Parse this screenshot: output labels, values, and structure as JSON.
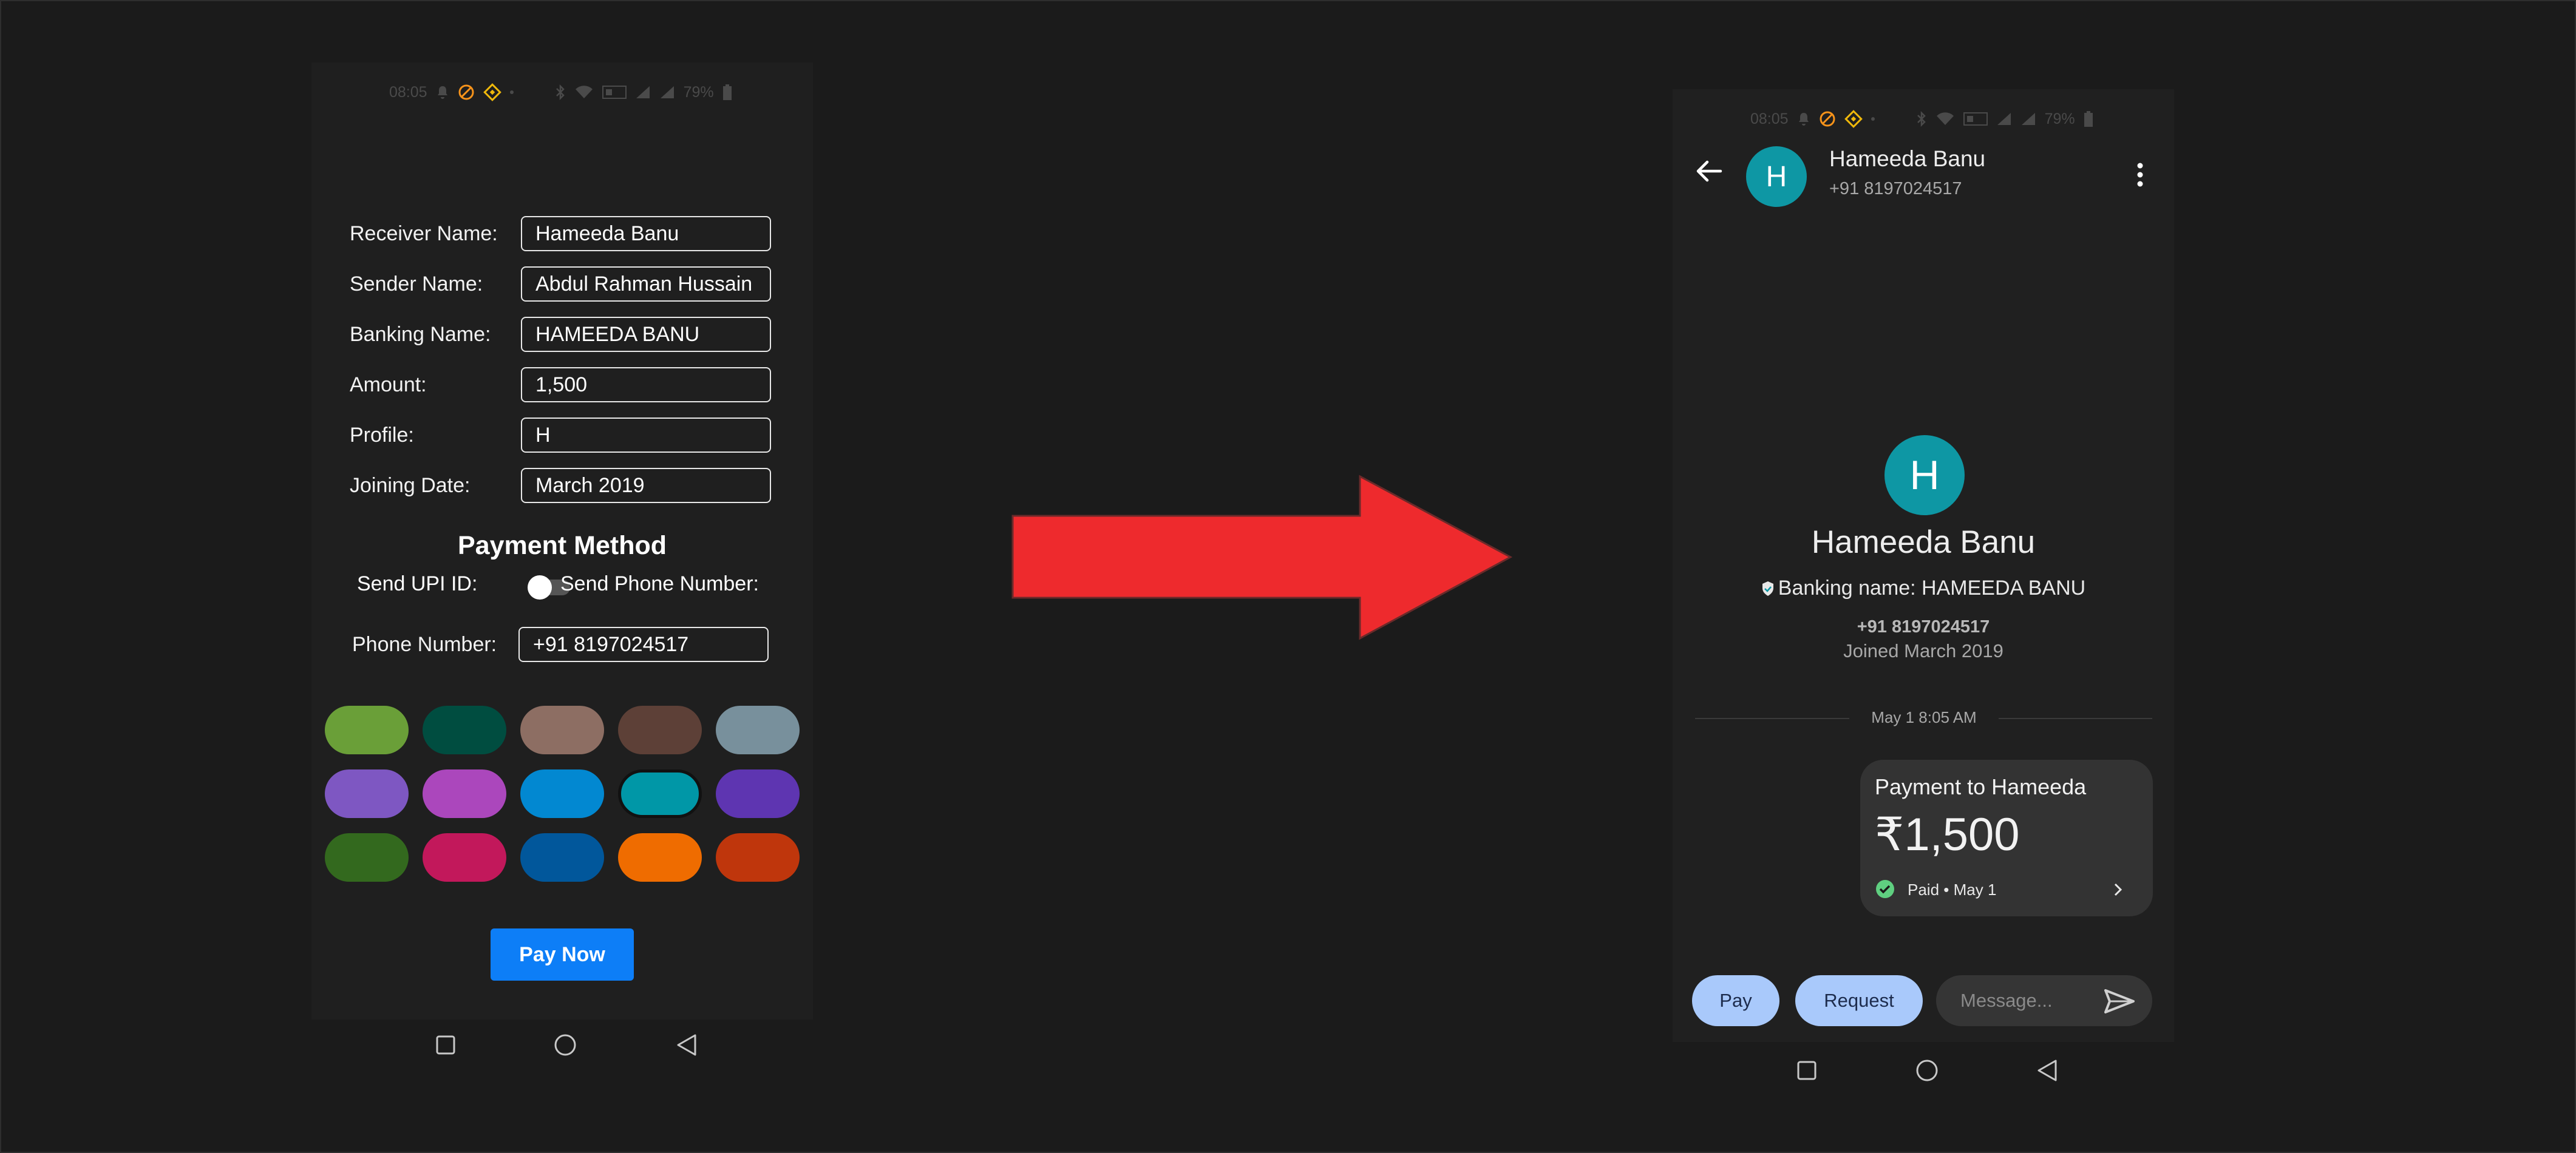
{
  "left": {
    "status": {
      "time": "08:05",
      "battery": "79%"
    },
    "form": {
      "receiver_label": "Receiver Name:",
      "receiver_value": "Hameeda Banu",
      "sender_label": "Sender Name:",
      "sender_value": "Abdul Rahman Hussain",
      "banking_label": "Banking Name:",
      "banking_value": "HAMEEDA BANU",
      "amount_label": "Amount:",
      "amount_value": "1,500",
      "profile_label": "Profile:",
      "profile_value": "H",
      "joining_label": "Joining Date:",
      "joining_value": "March 2019"
    },
    "payment_method": {
      "title": "Payment Method",
      "upi_label": "Send UPI ID:",
      "phone_toggle_label": "Send Phone Number:",
      "toggle_on": false,
      "phone_label": "Phone Number:",
      "phone_value": "+91 8197024517"
    },
    "colors": [
      [
        "#6a9f38",
        "#004d40",
        "#8d6e63",
        "#5d4037",
        "#78909c"
      ],
      [
        "#7e57c2",
        "#ab47bc",
        "#0288d1",
        "#0097a7",
        "#5e35b1"
      ],
      [
        "#33691e",
        "#c2185b",
        "#01579b",
        "#ef6c00",
        "#bf360c"
      ]
    ],
    "selected_color": "#0097a7",
    "pay_button": "Pay Now"
  },
  "arrow_color": "#ee2a2d",
  "right": {
    "status": {
      "time": "08:05",
      "battery": "79%"
    },
    "header": {
      "initial": "H",
      "name": "Hameeda Banu",
      "phone": "+91 8197024517"
    },
    "profile": {
      "initial": "H",
      "name": "Hameeda Banu",
      "banking": "Banking name: HAMEEDA BANU",
      "phone": "+91 8197024517",
      "joined": "Joined March 2019"
    },
    "divider_date": "May 1 8:05 AM",
    "payment": {
      "title": "Payment to Hameeda",
      "amount": "₹1,500",
      "status": "Paid",
      "date": "May 1"
    },
    "bottom": {
      "pay": "Pay",
      "request": "Request",
      "message_placeholder": "Message..."
    },
    "accent": "#0e97a4"
  }
}
